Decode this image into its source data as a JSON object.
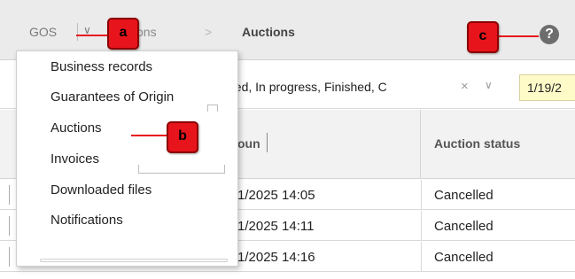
{
  "breadcrumb": {
    "root": "GOS",
    "partial": "ctions",
    "separator": ">",
    "current": "Auctions"
  },
  "help": {
    "label": "?"
  },
  "filter": {
    "status_value": "hed, In progress, Finished, C",
    "clear_glyph": "×",
    "dropdown_glyph": "∨",
    "date_value": "1/19/2"
  },
  "table": {
    "columns": [
      "oun",
      "Auction status"
    ],
    "rows": [
      {
        "date": "1/2025 14:05",
        "status": "Cancelled"
      },
      {
        "date": "1/2025 14:11",
        "status": "Cancelled"
      },
      {
        "date": "1/2025 14:16",
        "status": "Cancelled"
      }
    ]
  },
  "menu": {
    "items": [
      "Business records",
      "Guarantees of Origin",
      "Auctions",
      "Invoices",
      "Downloaded files",
      "Notifications"
    ]
  },
  "callouts": {
    "a": "a",
    "b": "b",
    "c": "c"
  },
  "colors": {
    "callout": "#e8141c",
    "date_highlight": "#fffbc8"
  }
}
